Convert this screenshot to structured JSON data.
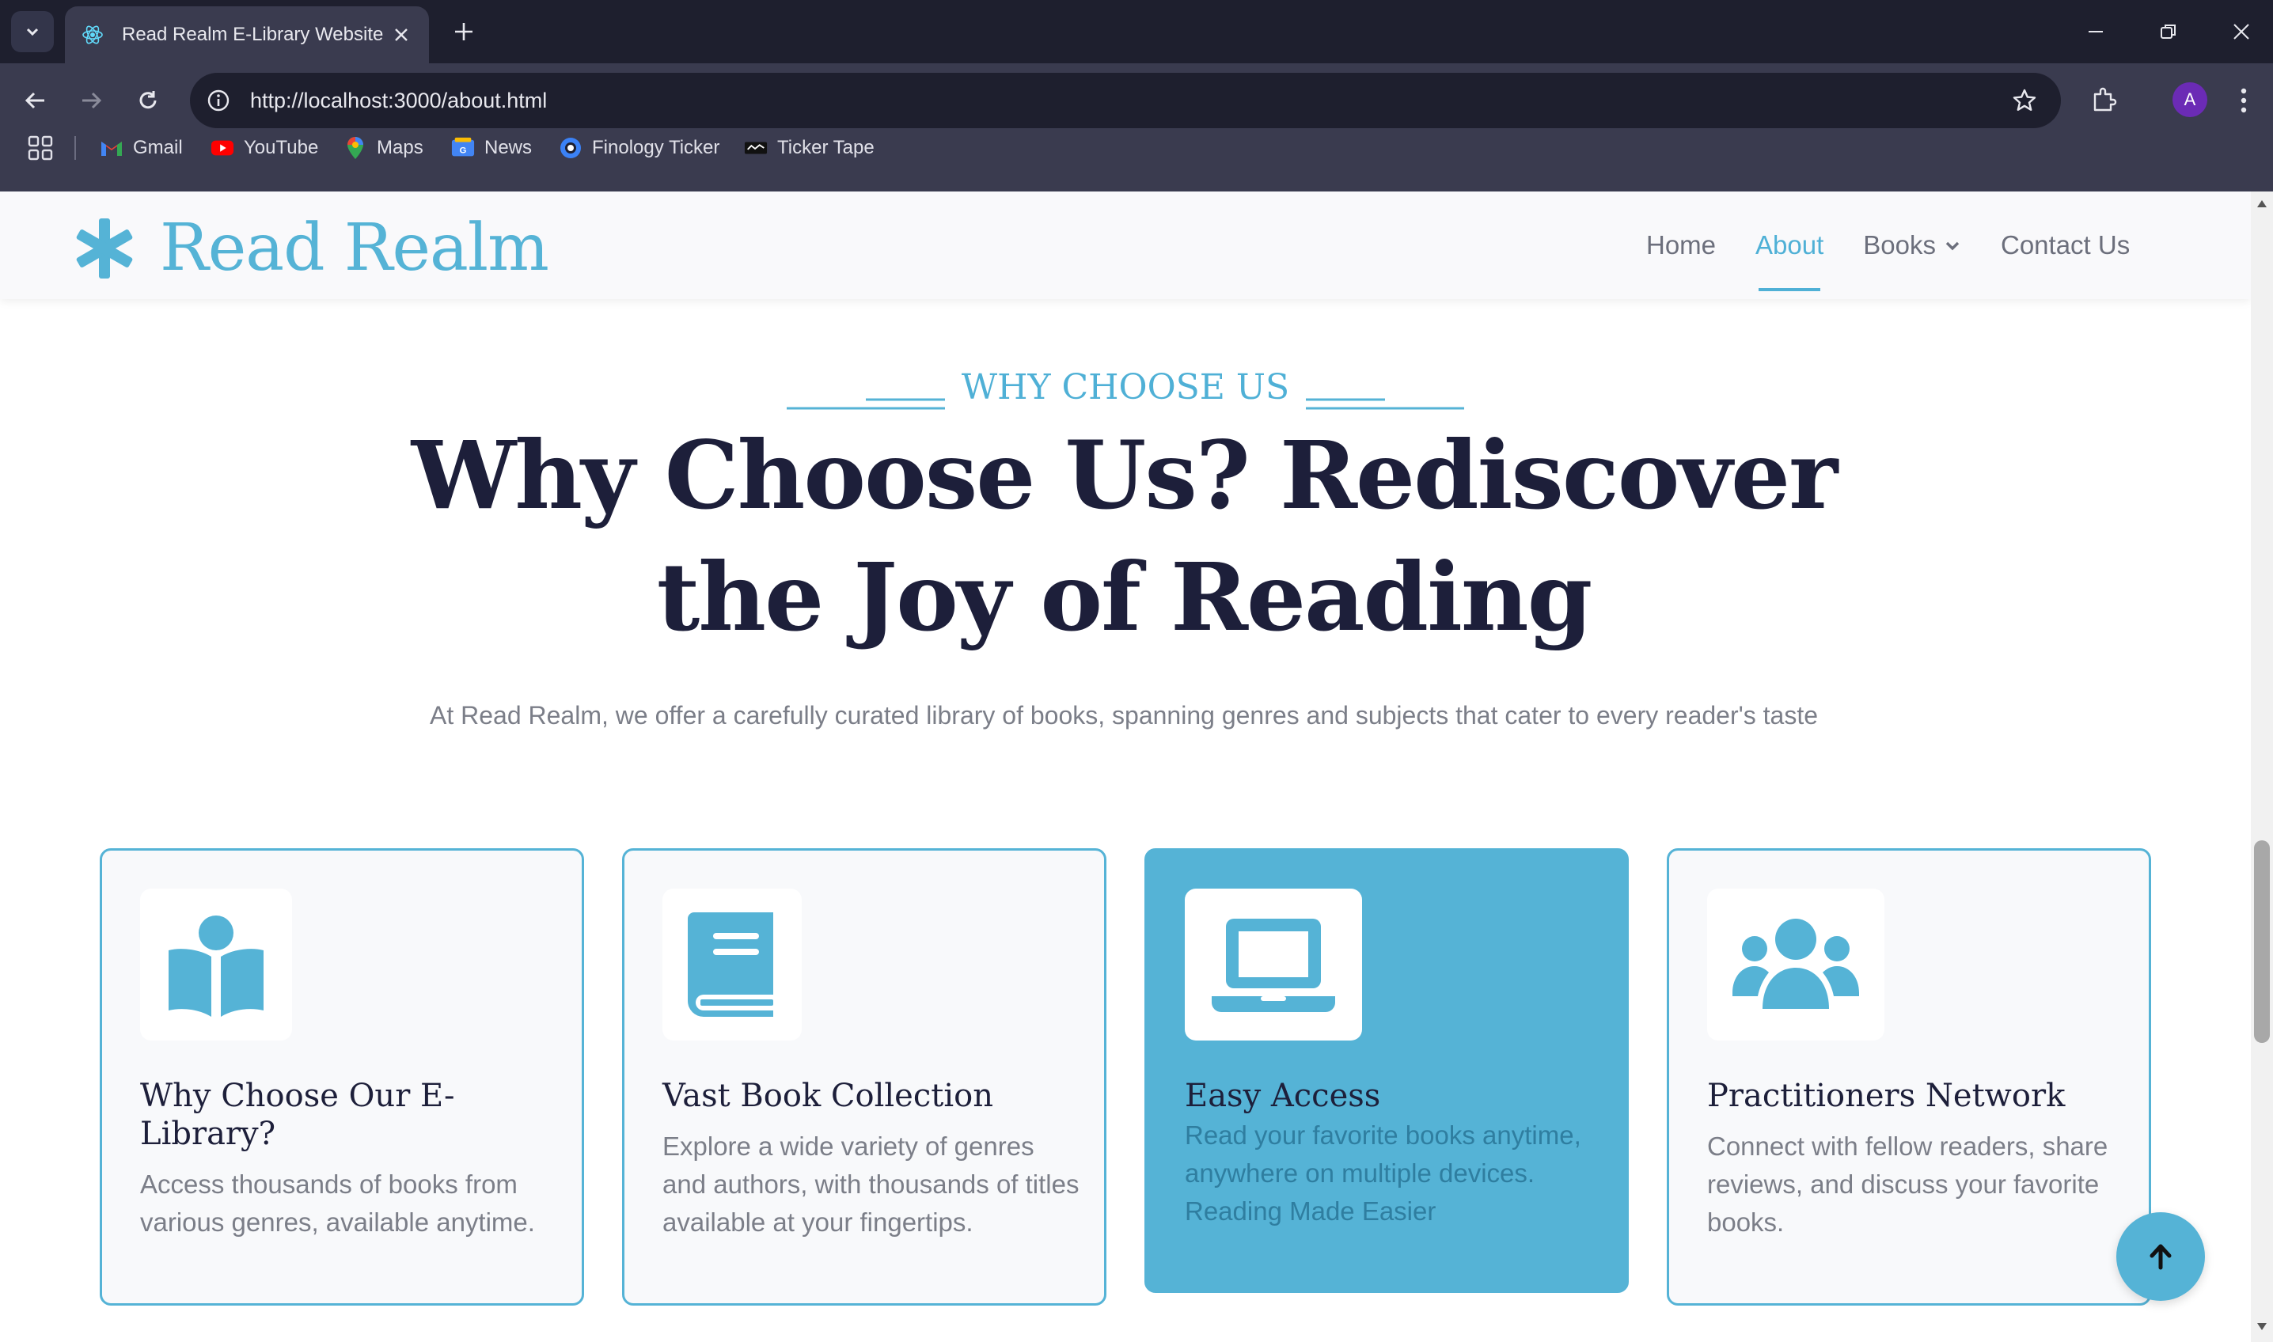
{
  "browser": {
    "tab_title": "Read Realm E-Library Website",
    "url": "http://localhost:3000/about.html",
    "profile_initial": "A",
    "bookmarks": [
      {
        "label": "Gmail",
        "icon": "gmail-icon"
      },
      {
        "label": "YouTube",
        "icon": "youtube-icon"
      },
      {
        "label": "Maps",
        "icon": "maps-icon"
      },
      {
        "label": "News",
        "icon": "news-icon"
      },
      {
        "label": "Finology Ticker",
        "icon": "finology-icon"
      },
      {
        "label": "Ticker Tape",
        "icon": "tickertape-icon"
      }
    ]
  },
  "site": {
    "logo_text": "Read Realm",
    "brand_color": "#55b3d6",
    "nav": [
      {
        "label": "Home",
        "active": false
      },
      {
        "label": "About",
        "active": true
      },
      {
        "label": "Books",
        "active": false,
        "has_dropdown": true
      },
      {
        "label": "Contact Us",
        "active": false
      }
    ]
  },
  "section": {
    "eyebrow": "WHY CHOOSE US",
    "headline_line1": "Why Choose Us? Rediscover",
    "headline_line2": "the Joy of Reading",
    "lead": "At Read Realm, we offer a carefully curated library of books, spanning genres and subjects that cater to every reader's taste"
  },
  "cards": [
    {
      "icon": "book-reader-icon",
      "title": "Why Choose Our E-Library?",
      "text": "Access thousands of books from various genres, available anytime.",
      "highlighted": false
    },
    {
      "icon": "book-icon",
      "title": "Vast Book Collection",
      "text": "Explore a wide variety of genres and authors, with thousands of titles available at your fingertips.",
      "highlighted": false
    },
    {
      "icon": "laptop-icon",
      "title": "Easy Access",
      "text": "Read your favorite books anytime, anywhere on multiple devices. Reading Made Easier",
      "highlighted": true
    },
    {
      "icon": "users-icon",
      "title": "Practitioners Network",
      "text": "Connect with fellow readers, share reviews, and discuss your favorite books.",
      "highlighted": false
    }
  ]
}
